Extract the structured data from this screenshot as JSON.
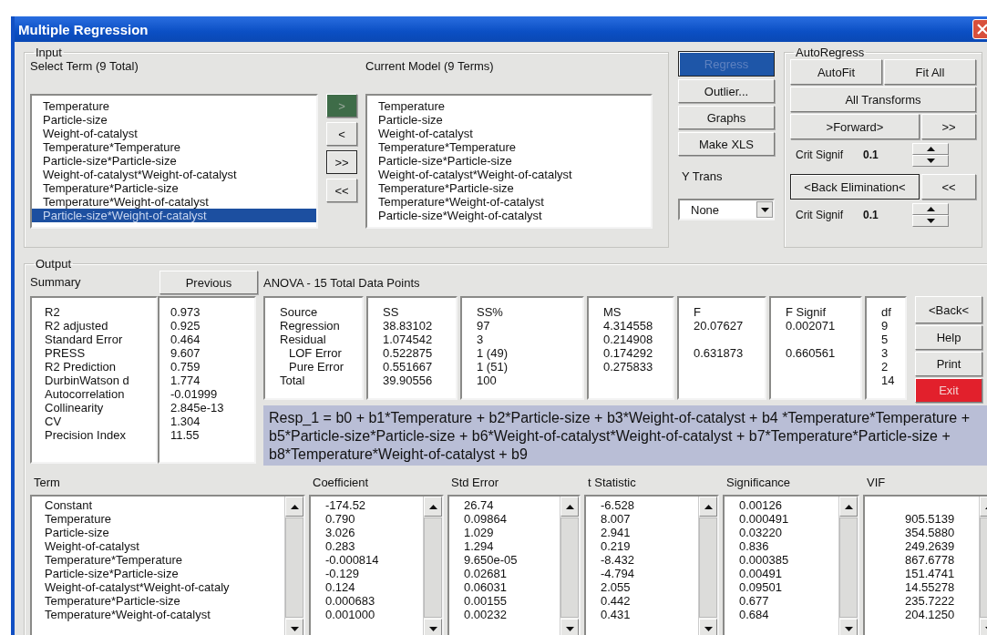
{
  "window": {
    "title": "Multiple Regression"
  },
  "input": {
    "label": "Input",
    "select_heading": "Select Term (9 Total)",
    "model_heading": "Current Model (9 Terms)",
    "select_terms": [
      {
        "label": "Temperature",
        "selected": false
      },
      {
        "label": "Particle-size",
        "selected": false
      },
      {
        "label": "Weight-of-catalyst",
        "selected": false
      },
      {
        "label": "Temperature*Temperature",
        "selected": false
      },
      {
        "label": "Particle-size*Particle-size",
        "selected": false
      },
      {
        "label": "Weight-of-catalyst*Weight-of-catalyst",
        "selected": false
      },
      {
        "label": "Temperature*Particle-size",
        "selected": false
      },
      {
        "label": "Temperature*Weight-of-catalyst",
        "selected": false
      },
      {
        "label": "Particle-size*Weight-of-catalyst",
        "selected": true
      }
    ],
    "move_buttons": [
      {
        "label": ">",
        "active": true
      },
      {
        "label": "<",
        "active": false
      },
      {
        "label": ">>",
        "active": false
      },
      {
        "label": "<<",
        "active": false
      }
    ],
    "model_terms": [
      "Temperature",
      "Particle-size",
      "Weight-of-catalyst",
      "Temperature*Temperature",
      "Particle-size*Particle-size",
      "Weight-of-catalyst*Weight-of-catalyst",
      "Temperature*Particle-size",
      "Temperature*Weight-of-catalyst",
      "Particle-size*Weight-of-catalyst"
    ]
  },
  "actions": [
    {
      "label": "Regress",
      "active": true
    },
    {
      "label": "Outlier...",
      "active": false
    },
    {
      "label": "Graphs",
      "active": false
    },
    {
      "label": "Make XLS",
      "active": false
    }
  ],
  "y_trans": {
    "label": "Y Trans",
    "value": "None"
  },
  "autoregress": {
    "label": "AutoRegress",
    "autofit": "AutoFit",
    "fit_all": "Fit All",
    "all_transforms": "All Transforms",
    "forward": {
      "label": ">Forward>",
      "step": ">>",
      "crit_label": "Crit Signif",
      "crit_value": "0.1",
      "default": false
    },
    "backward": {
      "label": "<Back Elimination<",
      "step": "<<",
      "crit_label": "Crit Signif",
      "crit_value": "0.1",
      "default": true
    }
  },
  "output": {
    "label": "Output",
    "summary_heading": "Summary",
    "previous_button": "Previous",
    "summary": [
      {
        "name": "R2",
        "value": "0.973"
      },
      {
        "name": "R2 adjusted",
        "value": "0.925"
      },
      {
        "name": "Standard Error",
        "value": "0.464"
      },
      {
        "name": "PRESS",
        "value": "9.607"
      },
      {
        "name": "R2 Prediction",
        "value": "0.759"
      },
      {
        "name": "DurbinWatson d",
        "value": "1.774"
      },
      {
        "name": "Autocorrelation",
        "value": "-0.01999"
      },
      {
        "name": "Collinearity",
        "value": "2.845e-13"
      },
      {
        "name": "CV",
        "value": "1.304"
      },
      {
        "name": "Precision Index",
        "value": "11.55"
      }
    ],
    "anova_heading": "ANOVA - 15 Total Data Points",
    "anova_headers": [
      "Source",
      "SS",
      "SS%",
      "MS",
      "F",
      "F Signif",
      "df"
    ],
    "anova_rows": [
      {
        "sub": false,
        "cells": [
          "Regression",
          "38.83102",
          "97",
          "4.314558",
          "20.07627",
          "0.002071",
          "9"
        ]
      },
      {
        "sub": false,
        "cells": [
          "Residual",
          "1.074542",
          "3",
          "0.214908",
          null,
          null,
          "5"
        ]
      },
      {
        "sub": true,
        "cells": [
          "LOF Error",
          "0.522875",
          "1 (49)",
          "0.174292",
          "0.631873",
          "0.660561",
          "3"
        ]
      },
      {
        "sub": true,
        "cells": [
          "Pure Error",
          "0.551667",
          "1 (51)",
          "0.275833",
          null,
          null,
          "2"
        ]
      },
      {
        "sub": false,
        "cells": [
          "Total",
          "39.90556",
          "100",
          null,
          null,
          null,
          "14"
        ]
      }
    ],
    "side_buttons": [
      {
        "label": "<Back<",
        "kind": "normal"
      },
      {
        "label": "Help",
        "kind": "normal"
      },
      {
        "label": "Print",
        "kind": "normal"
      },
      {
        "label": "Exit",
        "kind": "exit"
      }
    ],
    "equation": "Resp_1 = b0 + b1*Temperature + b2*Particle-size + b3*Weight-of-catalyst + b4 *Temperature*Temperature + b5*Particle-size*Particle-size + b6*Weight-of-catalyst*Weight-of-catalyst + b7*Temperature*Particle-size + b8*Temperature*Weight-of-catalyst + b9",
    "coef_columns": [
      {
        "header": "Term",
        "cells": [
          "Constant",
          "Temperature",
          "Particle-size",
          "Weight-of-catalyst",
          "Temperature*Temperature",
          "Particle-size*Particle-size",
          "Weight-of-catalyst*Weight-of-cataly",
          "Temperature*Particle-size",
          "Temperature*Weight-of-catalyst"
        ]
      },
      {
        "header": "Coefficient",
        "cells": [
          "-174.52",
          "0.790",
          "3.026",
          "0.283",
          "-0.000814",
          "-0.129",
          "0.124",
          "0.000683",
          "0.001000"
        ]
      },
      {
        "header": "Std Error",
        "cells": [
          "26.74",
          "0.09864",
          "1.029",
          "1.294",
          "9.650e-05",
          "0.02681",
          "0.06031",
          "0.00155",
          "0.00232"
        ]
      },
      {
        "header": "t Statistic",
        "cells": [
          "-6.528",
          "8.007",
          "2.941",
          "0.219",
          "-8.432",
          "-4.794",
          "2.055",
          "0.442",
          "0.431"
        ]
      },
      {
        "header": "Significance",
        "cells": [
          "0.00126",
          "0.000491",
          "0.03220",
          "0.836",
          "0.000385",
          "0.00491",
          "0.09501",
          "0.677",
          "0.684"
        ]
      },
      {
        "header": "VIF",
        "cells": [
          null,
          "905.5139",
          "354.5880",
          "249.2639",
          "867.6778",
          "151.4741",
          "14.55278",
          "235.7222",
          "204.1250"
        ]
      }
    ]
  }
}
